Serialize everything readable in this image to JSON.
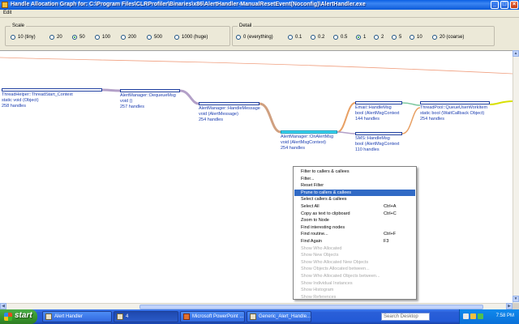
{
  "window": {
    "title": "Handle Allocation Graph for: C:\\Program Files\\CLRProfiler\\Binaries\\x86\\AlertHandler-ManualResetEvent(Noconfig)\\AlertHandler.exe",
    "minimize": "_",
    "maximize": "□",
    "close": "×"
  },
  "menu": {
    "edit": "Edit"
  },
  "scale": {
    "label": "Scale",
    "options": [
      "10 (tiny)",
      "20",
      "50",
      "100",
      "200",
      "500",
      "1000 (huge)"
    ],
    "selected": "50"
  },
  "detail": {
    "label": "Detail",
    "options": [
      "0 (everything)",
      "0.1",
      "0.2",
      "0.5",
      "1",
      "2",
      "5",
      "10",
      "20 (coarse)"
    ],
    "selected": "1"
  },
  "nodes": [
    {
      "name": "ThreadHelper::ThreadStart_Context",
      "sig": "static void (Object)",
      "count": "258 handles"
    },
    {
      "name": "AlertManager::DequeueMsg",
      "sig": "void ()",
      "count": "257 handles"
    },
    {
      "name": "AlertManager::HandleMessage",
      "sig": "void (AlertMessage)",
      "count": "254 handles"
    },
    {
      "name": "AlertManager::OnAlertMsg",
      "sig": "void (AlertMsgContext)",
      "count": "254 handles"
    },
    {
      "name": "Email::HandleMsg",
      "sig": "bool (AlertMsgContext",
      "count": "144 handles"
    },
    {
      "name": "SMS::HandleMsg",
      "sig": "bool (AlertMsgContext",
      "count": "110 handles"
    },
    {
      "name": "ThreadPool::QueueUserWorkItem",
      "sig": "static bool (WaitCallback Object)",
      "count": "254 handles"
    }
  ],
  "context_menu": [
    {
      "label": "Filter to callers & callees",
      "shortcut": ""
    },
    {
      "label": "Filter...",
      "shortcut": ""
    },
    {
      "label": "Reset Filter",
      "shortcut": ""
    },
    {
      "label": "Prune to callers & callees",
      "shortcut": ""
    },
    {
      "label": "Select callers & callees",
      "shortcut": ""
    },
    {
      "label": "Select All",
      "shortcut": "Ctrl+A"
    },
    {
      "label": "Copy as text to clipboard",
      "shortcut": "Ctrl+C"
    },
    {
      "label": "Zoom to Node",
      "shortcut": ""
    },
    {
      "label": "Find interesting nodes",
      "shortcut": ""
    },
    {
      "label": "Find routine...",
      "shortcut": "Ctrl+F"
    },
    {
      "label": "Find Again",
      "shortcut": "F3"
    },
    {
      "label": "Show Who Allocated",
      "shortcut": ""
    },
    {
      "label": "Show New Objects",
      "shortcut": ""
    },
    {
      "label": "Show Who Allocated New Objects",
      "shortcut": ""
    },
    {
      "label": "Show Objects Allocated between...",
      "shortcut": ""
    },
    {
      "label": "Show Who Allocated Objects between...",
      "shortcut": ""
    },
    {
      "label": "Show Individual Instances",
      "shortcut": ""
    },
    {
      "label": "Show Histogram",
      "shortcut": ""
    },
    {
      "label": "Show References",
      "shortcut": ""
    }
  ],
  "context_menu_highlight": "Prune to callers & callees",
  "taskbar": {
    "start": "start",
    "tasks": [
      "Alert Handler",
      "4",
      "Microsoft PowerPoint ...",
      "Generic_Alert_Handle..."
    ],
    "search": "Search Desktop",
    "clock": "7:58 PM"
  },
  "colors": {
    "edge_main": "#b3a0c8",
    "edge_orange": "#e8a064",
    "highlight_bar": "#38d6f2",
    "menu_highlight": "#316ac5"
  }
}
